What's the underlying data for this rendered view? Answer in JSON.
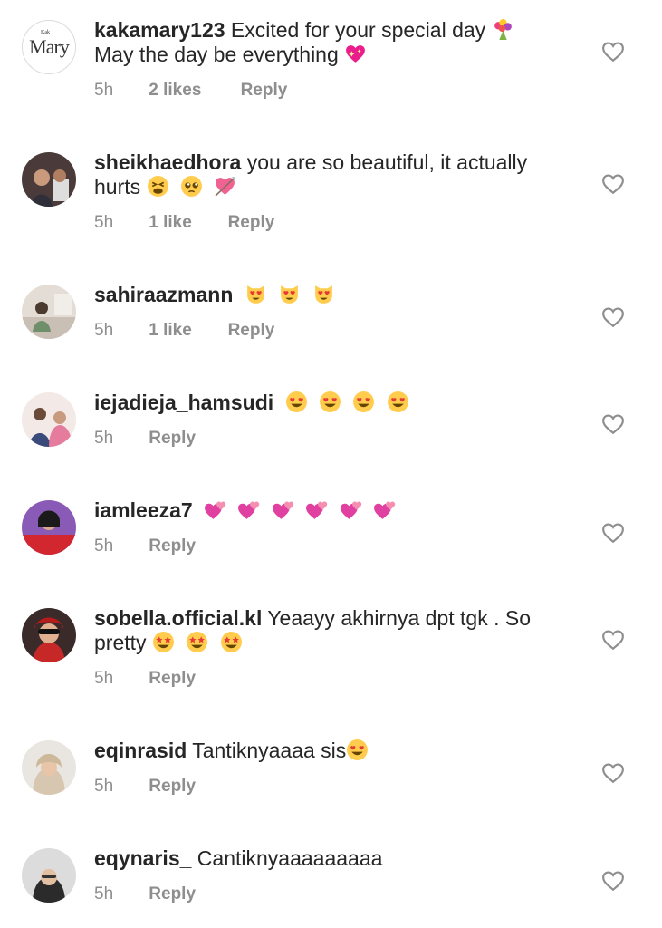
{
  "comments": [
    {
      "username": "kakamary123",
      "text": "Excited for your special day",
      "text_line2": "May the day be everything",
      "time": "5h",
      "likes": "2 likes",
      "reply": "Reply",
      "avatar_logo": "Mary",
      "avatar_logo_small": "Kak",
      "emojis": [
        "bouquet-emoji"
      ],
      "emojis_line2": [
        "sparkling-heart-emoji"
      ]
    },
    {
      "username": "sheikhaedhora",
      "text": "you are so beautiful, it actually",
      "text_line2": "hurts",
      "time": "5h",
      "likes": "1 like",
      "reply": "Reply",
      "emojis_line2": [
        "tired-face-emoji",
        "pleading-face-emoji",
        "heart-with-arrow-emoji"
      ]
    },
    {
      "username": "sahiraazmann",
      "text": "",
      "time": "5h",
      "likes": "1 like",
      "reply": "Reply",
      "emojis": [
        "heart-eyes-cat-emoji",
        "heart-eyes-cat-emoji",
        "heart-eyes-cat-emoji"
      ]
    },
    {
      "username": "iejadieja_hamsudi",
      "text": "",
      "time": "5h",
      "reply": "Reply",
      "emojis": [
        "heart-eyes-emoji",
        "heart-eyes-emoji",
        "heart-eyes-emoji",
        "heart-eyes-emoji"
      ]
    },
    {
      "username": "iamleeza7",
      "text": "",
      "time": "5h",
      "reply": "Reply",
      "emojis": [
        "two-hearts-emoji",
        "two-hearts-emoji",
        "two-hearts-emoji",
        "two-hearts-emoji",
        "two-hearts-emoji",
        "two-hearts-emoji"
      ]
    },
    {
      "username": "sobella.official.kl",
      "text": "Yeaayy akhirnya dpt tgk . So",
      "text_line2": "pretty",
      "time": "5h",
      "reply": "Reply",
      "emojis_line2": [
        "star-struck-emoji",
        "star-struck-emoji",
        "star-struck-emoji"
      ]
    },
    {
      "username": "eqinrasid",
      "text": "Tantiknyaaaa sis",
      "time": "5h",
      "reply": "Reply",
      "emojis": [
        "heart-eyes-emoji"
      ]
    },
    {
      "username": "eqynaris_",
      "text": "Cantiknyaaaaaaaaa",
      "time": "5h",
      "reply": "Reply"
    }
  ],
  "colors": {
    "text": "#262626",
    "meta": "#8e8e8e",
    "heart_outline": "#8e8e8e"
  }
}
